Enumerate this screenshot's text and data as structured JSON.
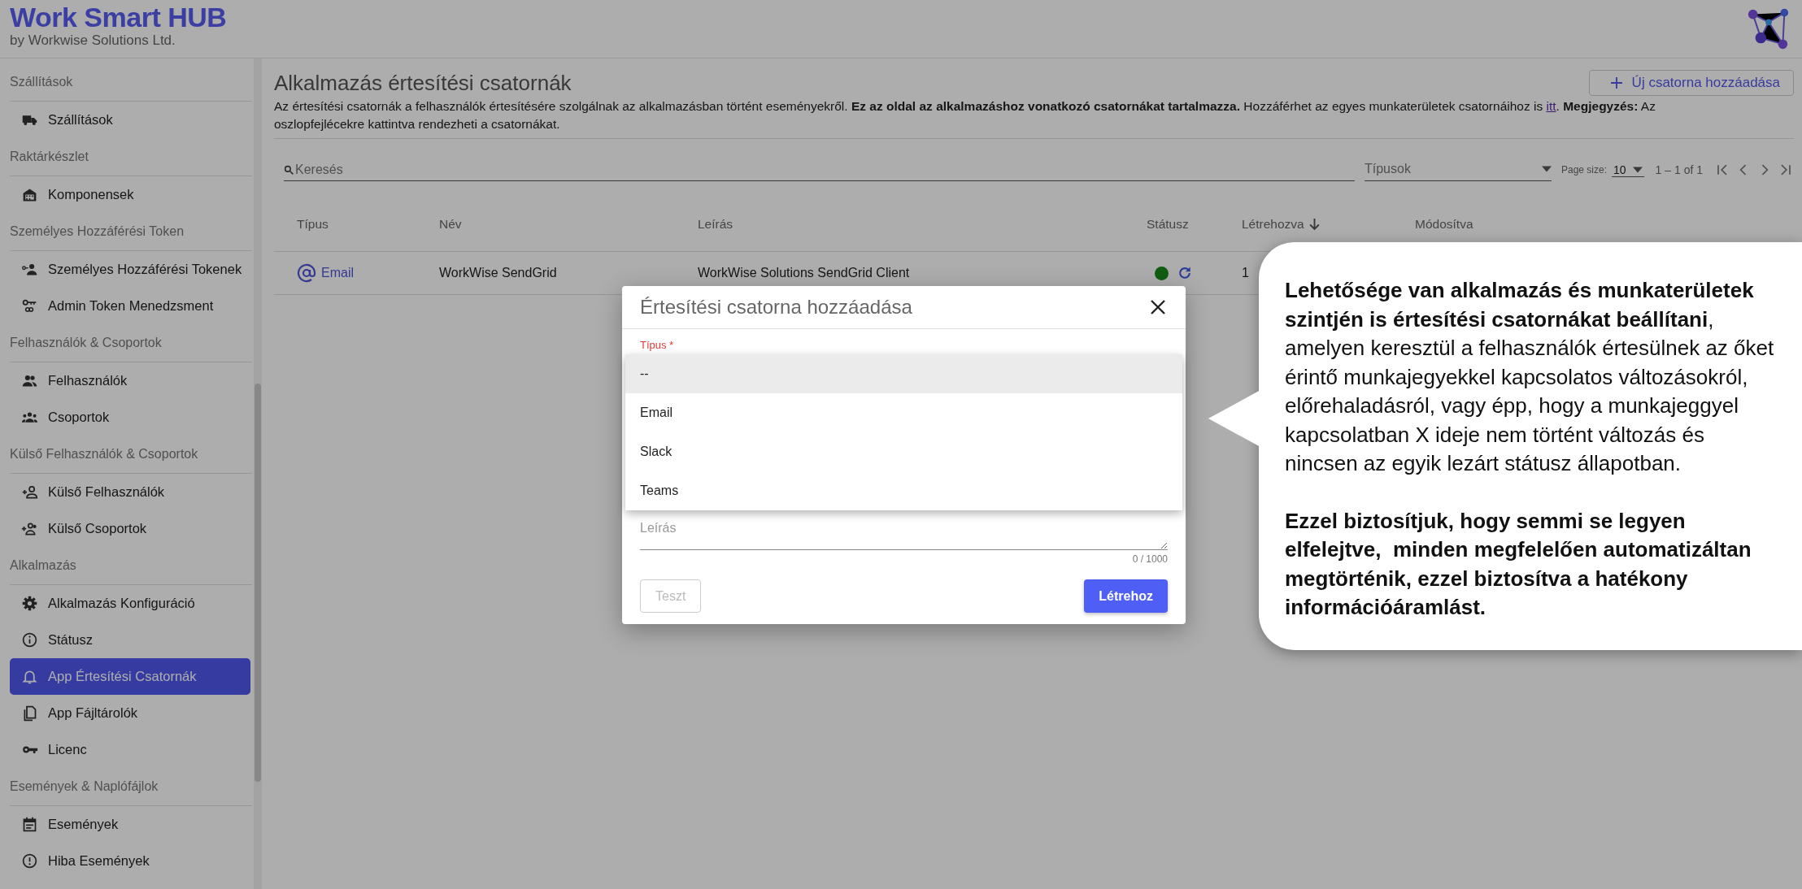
{
  "app": {
    "title": "Work Smart HUB",
    "subtitle": "by Workwise Solutions Ltd."
  },
  "sidebar": {
    "sections": [
      {
        "title": "Szállítások",
        "items": [
          {
            "label": "Szállítások",
            "selected": false
          }
        ]
      },
      {
        "title": "Raktárkészlet",
        "items": [
          {
            "label": "Komponensek",
            "selected": false
          }
        ]
      },
      {
        "title": "Személyes Hozzáférési Token",
        "items": [
          {
            "label": "Személyes Hozzáférési Tokenek",
            "selected": false
          },
          {
            "label": "Admin Token Menedzsment",
            "selected": false
          }
        ]
      },
      {
        "title": "Felhasználók & Csoportok",
        "items": [
          {
            "label": "Felhasználók",
            "selected": false
          },
          {
            "label": "Csoportok",
            "selected": false
          }
        ]
      },
      {
        "title": "Külső Felhasználók & Csoportok",
        "items": [
          {
            "label": "Külső Felhasználók",
            "selected": false
          },
          {
            "label": "Külső Csoportok",
            "selected": false
          }
        ]
      },
      {
        "title": "Alkalmazás",
        "items": [
          {
            "label": "Alkalmazás Konfiguráció",
            "selected": false
          },
          {
            "label": "Státusz",
            "selected": false
          },
          {
            "label": "App Értesítési Csatornák",
            "selected": true
          },
          {
            "label": "App Fájltárolók",
            "selected": false
          },
          {
            "label": "Licenc",
            "selected": false
          }
        ]
      },
      {
        "title": "Események & Naplófájlok",
        "items": [
          {
            "label": "Események",
            "selected": false
          },
          {
            "label": "Hiba Események",
            "selected": false
          }
        ]
      }
    ]
  },
  "page": {
    "title": "Alkalmazás értesítési csatornák",
    "add_button": "Új csatorna hozzáadása",
    "description": [
      {
        "kind": "text",
        "text": "Az értesítési csatornák a felhasználók értesítésére szolgálnak az alkalmazásban történt eseményekről. **Ez az oldal az alkalmazáshoz vonatkozó csatornákat tartalmazza.** Hozzáférhet az egyes munkaterületek csatornáihoz is "
      },
      {
        "kind": "link",
        "text": "itt"
      },
      {
        "kind": "text",
        "text": ". **Megjegyzés:** Az oszlopfejlécekre kattintva rendezheti a csatornákat."
      }
    ]
  },
  "toolbar": {
    "search": {
      "placeholder": "Keresés"
    },
    "type_filter": {
      "placeholder": "Típusok"
    },
    "page_size_label": "Page size:",
    "page_size": "10",
    "range": "1 – 1 of 1"
  },
  "table": {
    "columns": [
      {
        "label": "Típus",
        "sorted": false
      },
      {
        "label": "Név",
        "sorted": false
      },
      {
        "label": "Leírás",
        "sorted": false
      },
      {
        "label": "Státusz",
        "sorted": false
      },
      {
        "label": "Létrehozva",
        "sorted": true
      },
      {
        "label": "Módosítva",
        "sorted": false
      }
    ],
    "rows": [
      {
        "type": "Email",
        "name": "WorkWise SendGrid",
        "description": "WorkWise Solutions SendGrid Client",
        "active": true,
        "created": "1"
      }
    ]
  },
  "dialog": {
    "title": "Értesítési csatorna hozzáadása",
    "type_label": "Típus *",
    "options": [
      {
        "label": "--",
        "selected": true
      },
      {
        "label": "Email",
        "selected": false
      },
      {
        "label": "Slack",
        "selected": false
      },
      {
        "label": "Teams",
        "selected": false
      }
    ],
    "description": {
      "placeholder": "Leírás"
    },
    "counter": "0 / 1000",
    "buttons": [
      {
        "label": "Teszt",
        "disabled": true
      },
      {
        "label": "Létrehoz",
        "disabled": false
      }
    ]
  },
  "callout": {
    "paragraphs": [
      {
        "text": "**Lehetősége van alkalmazás és munkaterületek szintjén is értesítési csatornákat beállítani**, amelyen keresztül a felhasználók értesülnek az őket érintő munkajegyekkel kapcsolatos változásokról, előrehaladásról, vagy épp, hogy a munkajeggyel kapcsolatban X ideje nem történt változás és nincsen az egyik lezárt státusz állapotban.",
        "bold": false
      },
      {
        "text": "Ezzel biztosítjuk, hogy semmi se legyen elfelejtve,  minden megfelelően automatizáltan megtörténik, ezzel biztosítva a hatékony információáramlást.",
        "bold": true
      }
    ]
  }
}
